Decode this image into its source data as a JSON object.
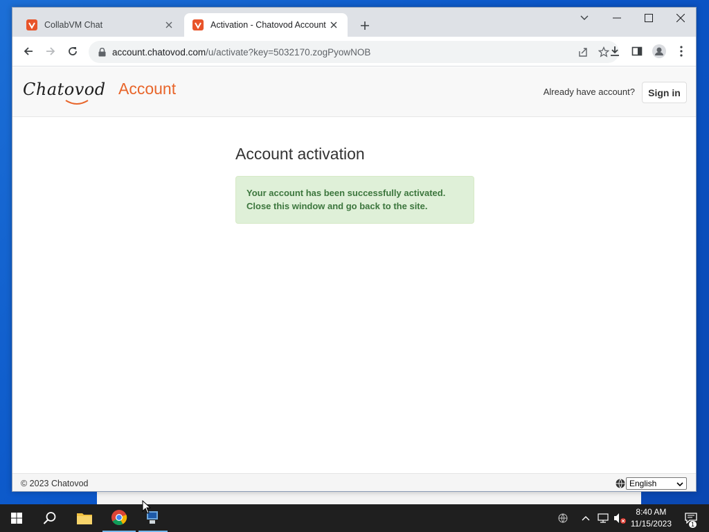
{
  "browser": {
    "tabs": [
      {
        "title": "CollabVM Chat",
        "active": false
      },
      {
        "title": "Activation - Chatovod Account",
        "active": true
      }
    ],
    "url": {
      "domain": "account.chatovod.com",
      "path": "/u/activate?key=5032170.zogPyowNOB"
    }
  },
  "site": {
    "logo_text": "Chatovod",
    "section": "Account",
    "already_text": "Already have account?",
    "signin_label": "Sign in"
  },
  "main": {
    "title": "Account activation",
    "alert_line1": "Your account has been successfully activated.",
    "alert_line2": "Close this window and go back to the site."
  },
  "footer": {
    "copyright": "© 2023 Chatovod",
    "language": "English"
  },
  "taskbar": {
    "time": "8:40 AM",
    "date": "11/15/2023",
    "notification_count": "1"
  },
  "colors": {
    "accent": "#e8652a",
    "success_bg": "#dff0d8",
    "success_text": "#3c763d",
    "taskbar": "#1f1f1f"
  }
}
